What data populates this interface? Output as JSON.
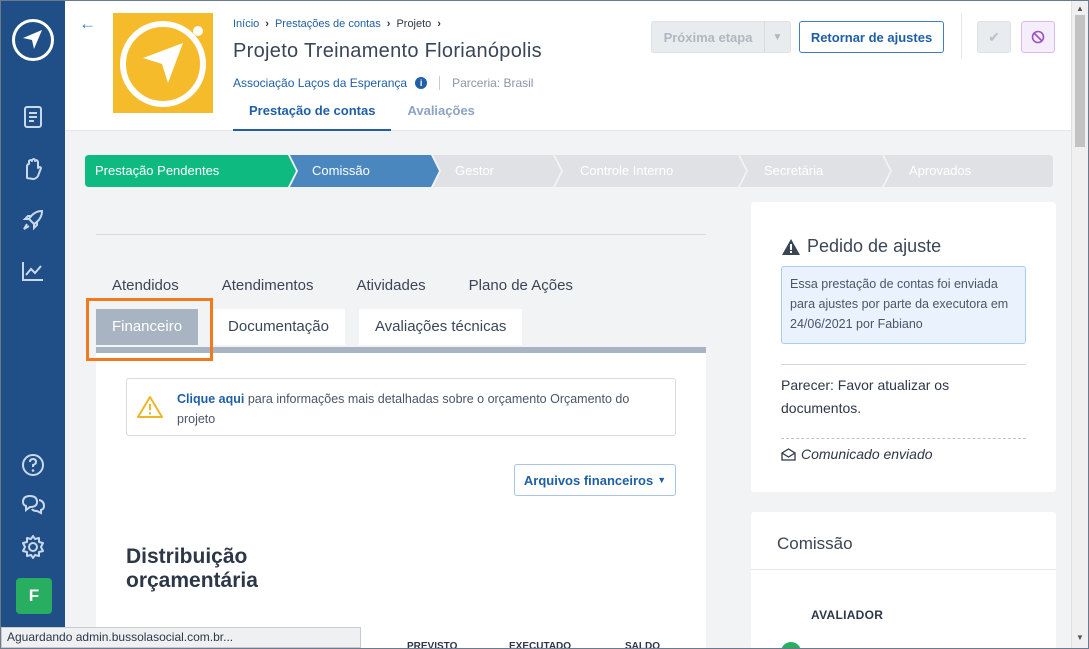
{
  "sidebar": {
    "logo": "bussola-logo",
    "items": [
      {
        "icon": "report-icon"
      },
      {
        "icon": "hand-heart-icon"
      },
      {
        "icon": "rocket-icon"
      },
      {
        "icon": "chart-line-icon"
      }
    ],
    "bottom": [
      {
        "icon": "help-icon"
      },
      {
        "icon": "chat-icon"
      },
      {
        "icon": "gear-icon"
      }
    ],
    "avatar_initial": "F"
  },
  "header": {
    "breadcrumb": [
      "Início",
      "Prestações de contas",
      "Projeto"
    ],
    "title": "Projeto Treinamento Florianópolis",
    "organization": "Associação Laços da Esperança",
    "partnership": "Parceria: Brasil",
    "tabs": [
      "Prestação de contas",
      "Avaliações"
    ],
    "next_step_label": "Próxima etapa",
    "return_label": "Retornar de ajustes"
  },
  "stepper": {
    "steps": [
      "Prestação Pendentes",
      "Comissão",
      "Gestor",
      "Controle Interno",
      "Secretária",
      "Aprovados"
    ],
    "colors": {
      "done": "#0fba81",
      "current": "#4a87be",
      "pending": "#dfe1e4"
    }
  },
  "tabs": {
    "row1": [
      "Atendidos",
      "Atendimentos",
      "Atividades",
      "Plano de Ações"
    ],
    "row2": [
      "Financeiro",
      "Documentação",
      "Avaliações técnicas"
    ],
    "active": "Financeiro"
  },
  "alert": {
    "link": "Clique aqui",
    "text": " para informações mais detalhadas sobre o orçamento Orçamento do projeto"
  },
  "files_button": "Arquivos financeiros",
  "section_title": "Distribuição orçamentária",
  "table_headers": [
    "PREVISTO",
    "EXECUTADO",
    "SALDO"
  ],
  "ajuste": {
    "title": "Pedido de ajuste",
    "message": "Essa prestação de contas foi enviada para ajustes por parte da executora em 24/06/2021 por Fabiano",
    "parecer": "Parecer: Favor atualizar os documentos.",
    "comunicado": "Comunicado enviado"
  },
  "comissao": {
    "title": "Comissão",
    "column": "AVALIADOR"
  },
  "statusbar": "Aguardando admin.bussolasocial.com.br..."
}
